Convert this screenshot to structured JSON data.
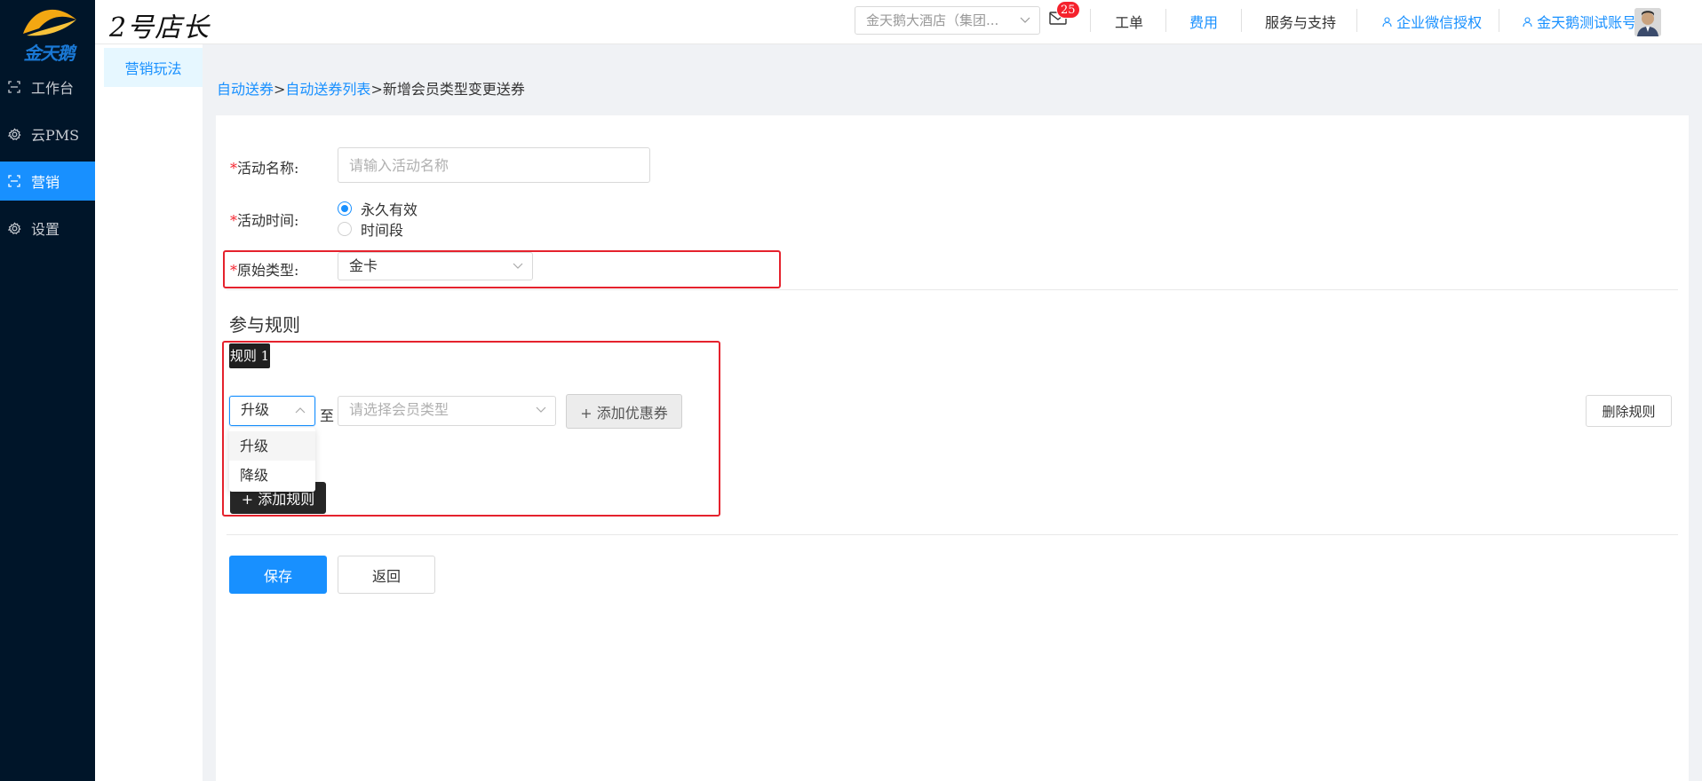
{
  "sidebar": {
    "logo_text": "金天鹅",
    "items": [
      {
        "label": "工作台",
        "icon": "dashboard-icon"
      },
      {
        "label": "云PMS",
        "icon": "gear-icon"
      },
      {
        "label": "营销",
        "icon": "dashboard-icon",
        "active": true
      },
      {
        "label": "设置",
        "icon": "gear-icon"
      }
    ]
  },
  "header": {
    "brand": "2号店长",
    "store_select": "金天鹅大酒店（集团...",
    "mail_badge": "25",
    "links": {
      "ticket": "工单",
      "fees": "费用",
      "support": "服务与支持",
      "wechat_auth": "企业微信授权",
      "account": "金天鹅测试账号"
    }
  },
  "submenu": {
    "active_item": "营销玩法"
  },
  "breadcrumb": {
    "items": [
      "自动送券",
      "自动送券列表",
      "新增会员类型变更送券"
    ],
    "separator": ">"
  },
  "form": {
    "activity_name": {
      "required_mark": "*",
      "label": "活动名称:",
      "value": "",
      "placeholder": "请输入活动名称"
    },
    "activity_time": {
      "required_mark": "*",
      "label": "活动时间:",
      "options": [
        {
          "label": "永久有效",
          "checked": true
        },
        {
          "label": "时间段",
          "checked": false
        }
      ]
    },
    "original_type": {
      "required_mark": "*",
      "label": "原始类型:",
      "value": "金卡"
    }
  },
  "rules": {
    "section_title": "参与规则",
    "rule_tag": "规则 1",
    "direction_select": {
      "value": "升级",
      "options": [
        "升级",
        "降级"
      ],
      "open": true
    },
    "to_label": "至",
    "member_type_select": {
      "placeholder": "请选择会员类型"
    },
    "add_coupon_label": "+ 添加优惠券",
    "delete_rule_label": "删除规则",
    "add_rule_label": "+ 添加规则"
  },
  "actions": {
    "save_label": "保存",
    "back_label": "返回"
  },
  "colors": {
    "primary": "#1890ff",
    "sidebar_bg": "#001529",
    "highlight_red": "#e5222d"
  }
}
